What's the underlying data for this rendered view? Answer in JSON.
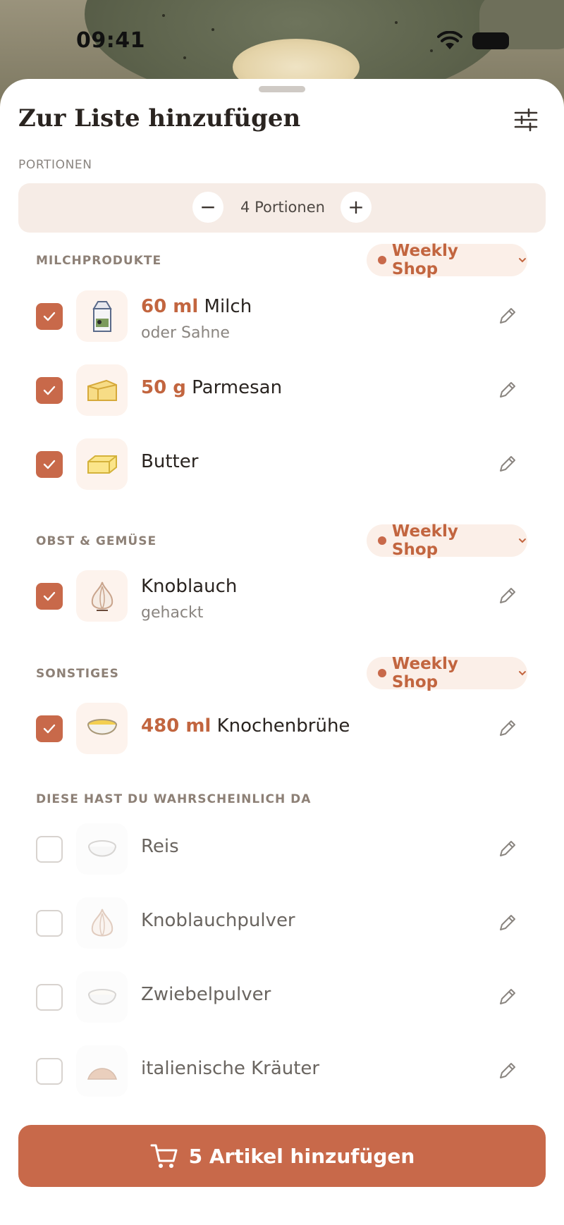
{
  "status_bar": {
    "time": "09:41"
  },
  "sheet": {
    "title": "Zur Liste hinzufügen",
    "portions_label": "PORTIONEN",
    "portions_value": "4 Portionen",
    "minus_label": "−",
    "plus_label": "+"
  },
  "sections": [
    {
      "label": "MILCHPRODUKTE",
      "shop": "Weekly Shop"
    },
    {
      "label": "OBST & GEMÜSE",
      "shop": "Weekly Shop"
    },
    {
      "label": "SONSTIGES",
      "shop": "Weekly Shop"
    },
    {
      "label": "DIESE HAST DU WAHRSCHEINLICH DA"
    }
  ],
  "items": [
    {
      "qty": "60 ml",
      "name": "Milch",
      "note": "oder Sahne",
      "checked": true,
      "icon": "milk-carton-icon"
    },
    {
      "qty": "50 g",
      "name": "Parmesan",
      "checked": true,
      "icon": "cheese-icon"
    },
    {
      "name": "Butter",
      "checked": true,
      "icon": "butter-icon"
    },
    {
      "name": "Knoblauch",
      "note": "gehackt",
      "checked": true,
      "icon": "garlic-icon"
    },
    {
      "qty": "480 ml",
      "name": "Knochenbrühe",
      "checked": true,
      "icon": "broth-bowl-icon"
    },
    {
      "name": "Reis",
      "checked": false,
      "icon": "rice-bowl-icon"
    },
    {
      "name": "Knoblauchpulver",
      "checked": false,
      "icon": "garlic-icon"
    },
    {
      "name": "Zwiebelpulver",
      "checked": false,
      "icon": "powder-bowl-icon"
    },
    {
      "name": "italienische Kräuter",
      "checked": false,
      "icon": "herbs-icon"
    }
  ],
  "cta": {
    "label": "5 Artikel hinzufügen"
  },
  "colors": {
    "accent": "#c8694a",
    "accent_text": "#c2653f",
    "pill_bg": "#fbefe8",
    "stepper_bg": "#f6ece6"
  }
}
